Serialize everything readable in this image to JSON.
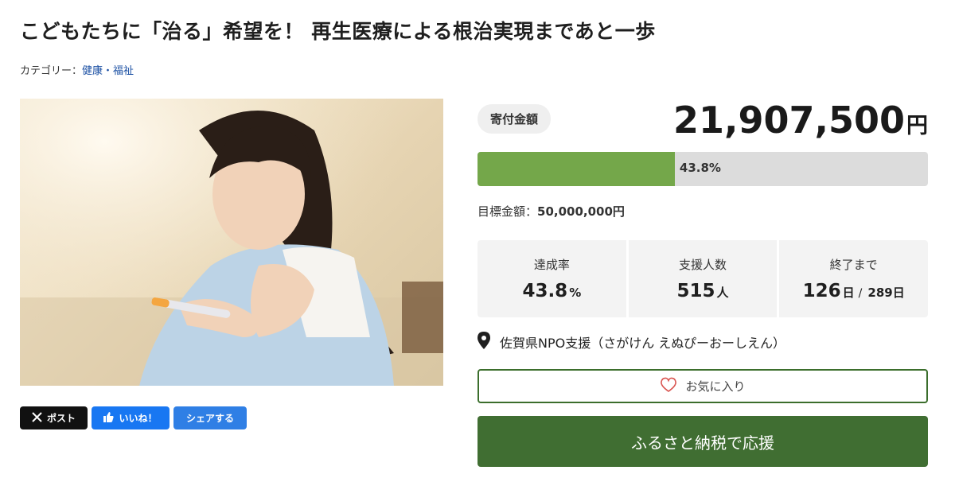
{
  "page": {
    "title": "こどもたちに「治る」希望を！ 再生医療による根治実現まであと一歩",
    "category_label": "カテゴリー：",
    "category_value": "健康・福祉"
  },
  "share": {
    "x_label": "ポスト",
    "like_label": "いいね！",
    "share_label": "シェアする"
  },
  "funding": {
    "badge": "寄付金額",
    "amount": "21,907,500",
    "amount_unit": "円",
    "progress_label": "43.8%",
    "progress_fraction": 0.438,
    "goal_label": "目標金額：",
    "goal_value": "50,000,000円"
  },
  "stats": {
    "rate_label": "達成率",
    "rate_value": "43.8",
    "rate_unit": "%",
    "supporters_label": "支援人数",
    "supporters_value": "515",
    "supporters_unit": "人",
    "remaining_label": "終了まで",
    "remaining_value": "126",
    "remaining_unit": "日",
    "total_sep": "/",
    "total_value": "289日"
  },
  "location": {
    "icon": "map-pin-icon",
    "text": "佐賀県NPO支援（さがけん えぬぴーおーしえん）"
  },
  "actions": {
    "favorite_label": "お気に入り",
    "donate_label": "ふるさと納税で応援"
  },
  "colors": {
    "progress_fill": "#74a74a",
    "progress_bg": "#dcdcdc",
    "donate_button": "#406e32",
    "favorite_border": "#3b6e2c",
    "link": "#1a4fa3"
  }
}
